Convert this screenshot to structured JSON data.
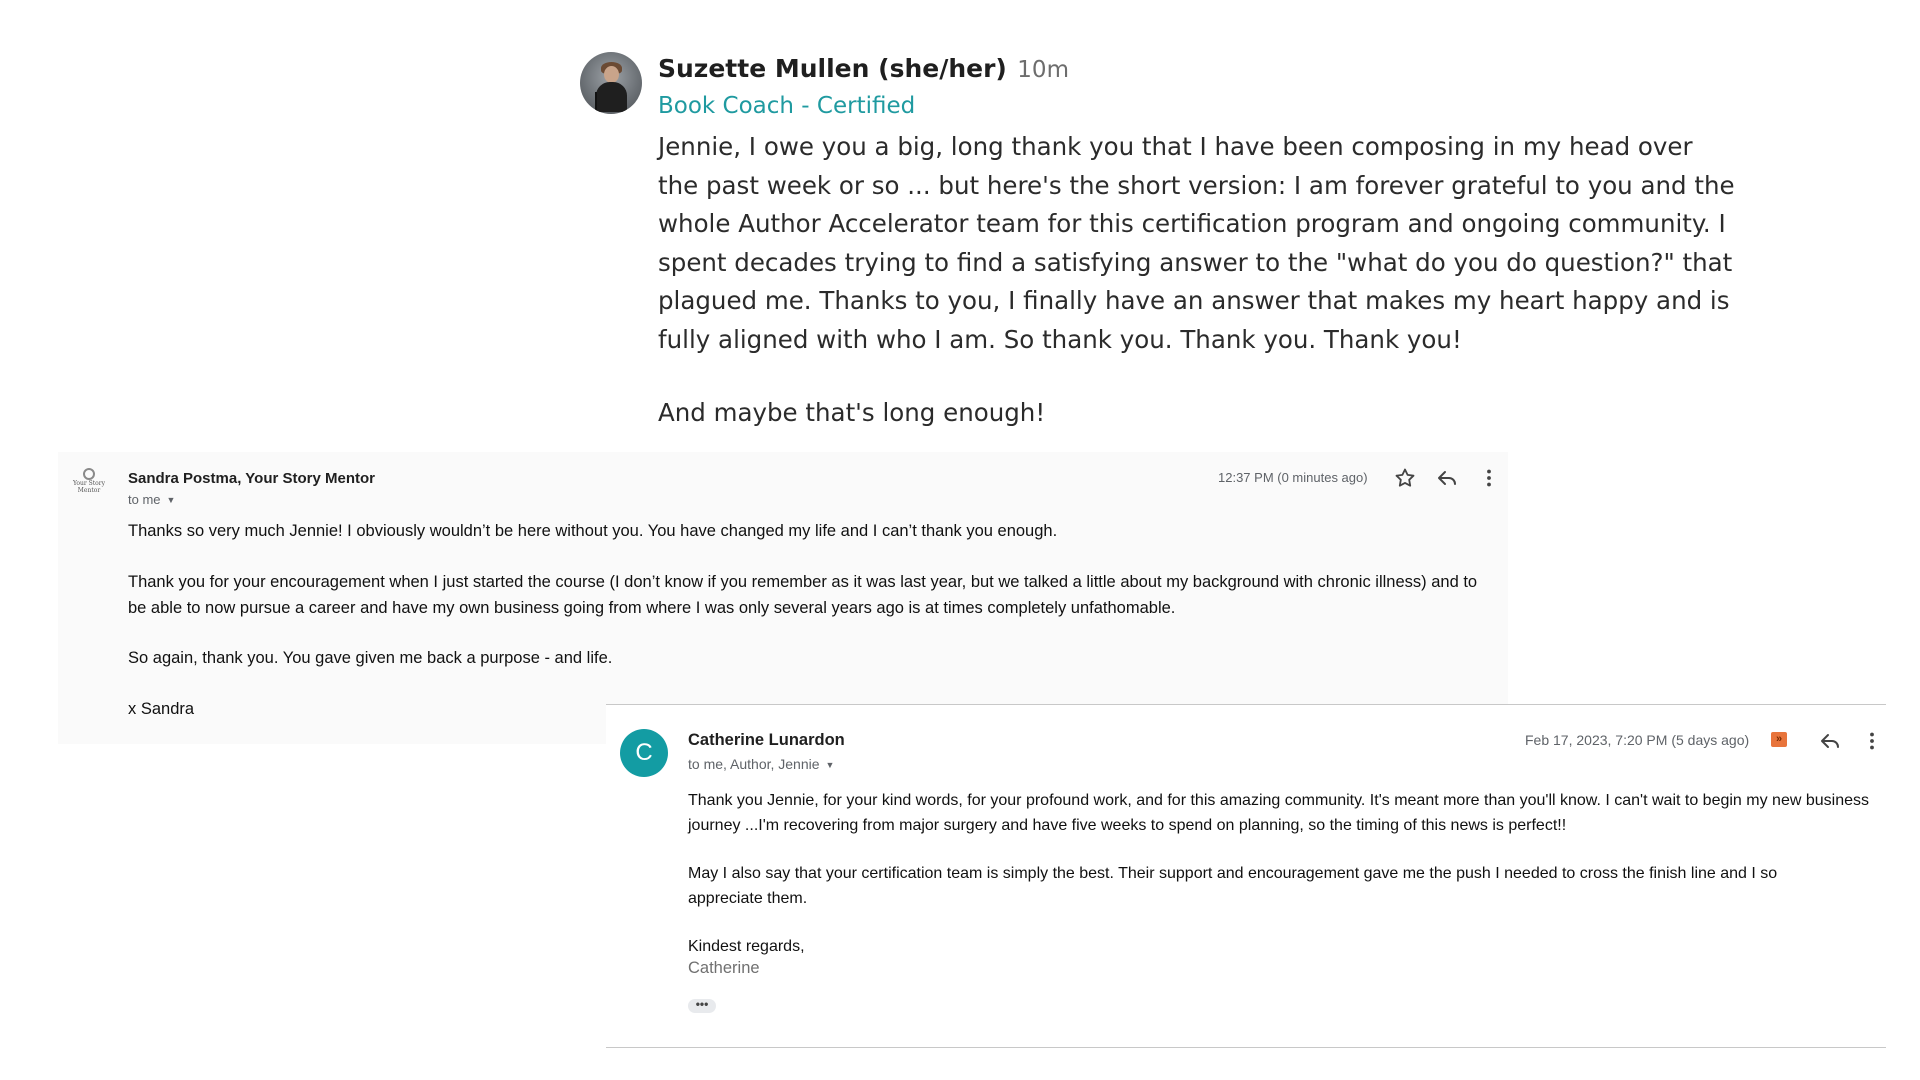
{
  "post": {
    "author": "Suzette Mullen (she/her)",
    "time": "10m",
    "badge": "Book Coach - Certified",
    "body": "Jennie, I owe you a big, long thank you that I have been composing in my head over the past week or so ... but here's the short version: I am forever grateful to you and the whole Author Accelerator team for this certification program and ongoing community. I spent decades trying to find a satisfying answer to the \"what do you do question?\" that plagued me. Thanks to you, I finally have an answer that makes my heart happy and is fully aligned with who I am. So thank you. Thank you. Thank you!",
    "closing": "And maybe that's long enough!"
  },
  "email1": {
    "logo_text": "Your Story Mentor",
    "sender": "Sandra Postma, Your Story Mentor",
    "recipients": "to me",
    "time": "12:37 PM (0 minutes ago)",
    "icons": [
      "star-icon",
      "reply-icon",
      "more-vert-icon"
    ],
    "paragraphs": [
      "Thanks so very much Jennie! I obviously wouldn’t be here without you. You have changed my life and I can’t thank you enough.",
      "Thank you for your encouragement when I just started the course (I don’t know if you remember as it was last year, but we talked a little about my background with chronic illness) and to be able to now pursue a career and have my own business going from where I was only several years ago is at times completely unfathomable.",
      "So again, thank you. You gave given me back a purpose - and life.",
      "x Sandra"
    ]
  },
  "email2": {
    "avatar_letter": "C",
    "avatar_color": "#139ca3",
    "sender": "Catherine Lunardon",
    "recipients": "to me, Author, Jennie",
    "time": "Feb 17, 2023, 7:20 PM (5 days ago)",
    "icons": [
      "important-marker-icon",
      "reply-icon",
      "more-vert-icon"
    ],
    "paragraphs": [
      "Thank you Jennie, for your kind words, for your profound work, and for this amazing community. It's meant more than you'll know. I can't wait to begin my new business journey ...I'm recovering from major surgery and have five weeks to spend on planning, so the timing of this news is perfect!!",
      "May I also say that your certification team is simply the best. Their support and encouragement gave me the push I needed to cross the finish line and I so appreciate them.",
      "Kindest regards,"
    ],
    "signature": "Catherine",
    "ellipsis": "•••"
  },
  "colors": {
    "badge": "#1f9aa0",
    "avatar": "#139ca3",
    "important": "#e8743b"
  }
}
